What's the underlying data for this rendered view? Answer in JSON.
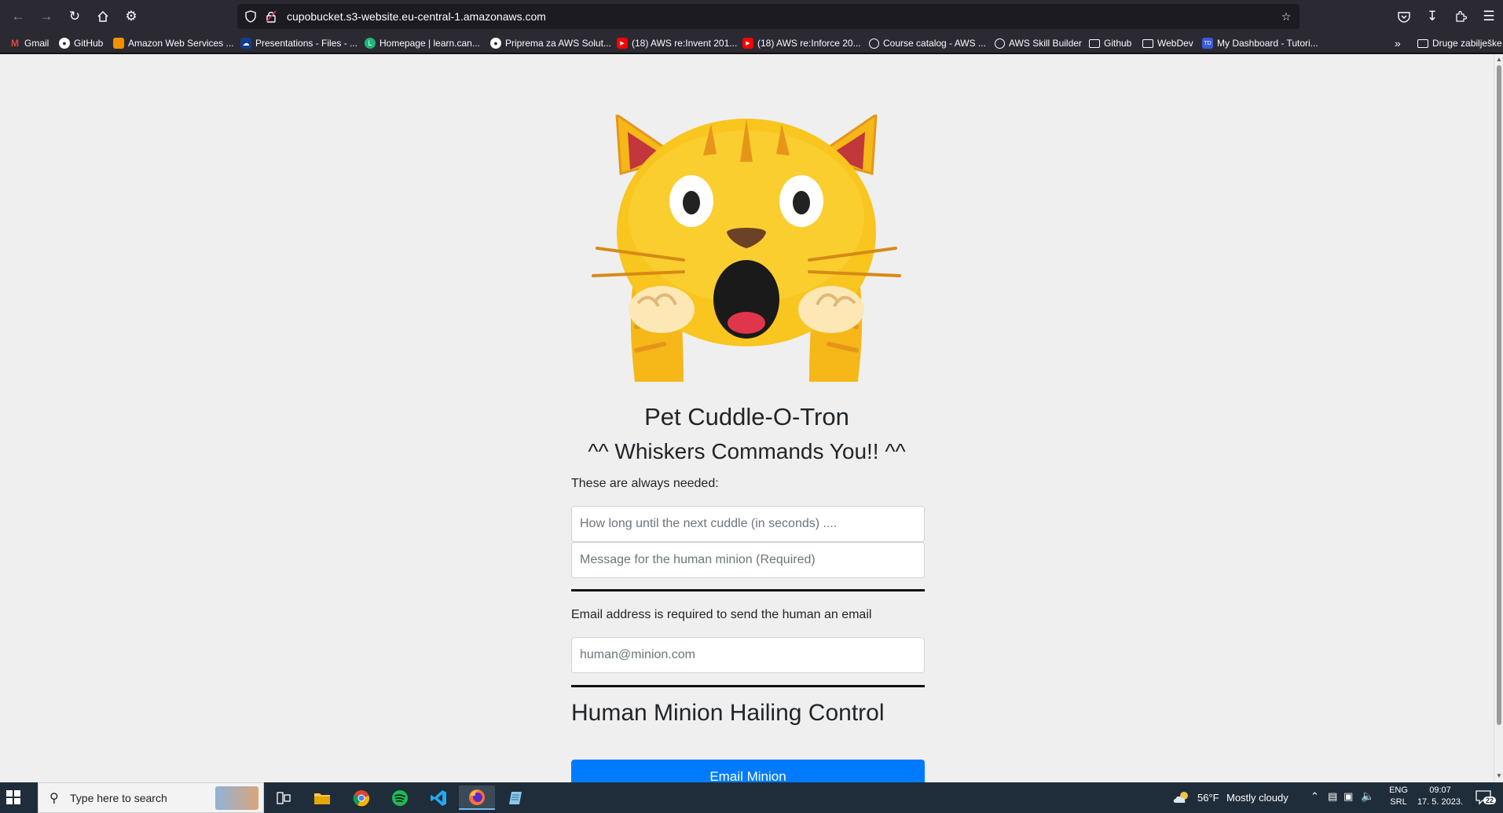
{
  "browser": {
    "url": "cupobucket.s3-website.eu-central-1.amazonaws.com",
    "bookmarks": [
      {
        "label": "Gmail",
        "icon": "gmail-icon",
        "color": "#ea4335"
      },
      {
        "label": "GitHub",
        "icon": "github-icon",
        "color": "#ffffff"
      },
      {
        "label": "Amazon Web Services ...",
        "icon": "aws-icon",
        "color": "#f29100"
      },
      {
        "label": "Presentations - Files - ...",
        "icon": "cloud-icon",
        "color": "#ffffff"
      },
      {
        "label": "Homepage | learn.can...",
        "icon": "learn-icon",
        "color": "#1fb57b"
      },
      {
        "label": "Priprema za AWS Solut...",
        "icon": "github-icon",
        "color": "#ffffff"
      },
      {
        "label": "(18) AWS re:Invent 201...",
        "icon": "youtube-icon",
        "color": "#ff0000"
      },
      {
        "label": "(18) AWS re:Inforce 20...",
        "icon": "youtube-icon",
        "color": "#ff0000"
      },
      {
        "label": "Course catalog - AWS ...",
        "icon": "globe-icon",
        "color": "#ffffff"
      },
      {
        "label": "AWS Skill Builder",
        "icon": "globe-icon",
        "color": "#ffffff"
      },
      {
        "label": "Github",
        "icon": "folder-icon",
        "color": "#ffffff"
      },
      {
        "label": "WebDev",
        "icon": "folder-icon",
        "color": "#ffffff"
      },
      {
        "label": "My Dashboard - Tutori...",
        "icon": "dashboard-icon",
        "color": "#3b5bdb"
      }
    ],
    "other_bookmarks": "Druge zabilješke"
  },
  "page": {
    "title": "Pet Cuddle-O-Tron",
    "subtitle": "^^ Whiskers Commands You!! ^^",
    "always_needed_label": "These are always needed:",
    "wait_placeholder": "How long until the next cuddle (in seconds) ....",
    "message_placeholder": "Message for the human minion (Required)",
    "email_label": "Email address is required to send the human an email",
    "email_placeholder": "human@minion.com",
    "control_heading": "Human Minion Hailing Control",
    "email_button": "Email Minion"
  },
  "taskbar": {
    "search_placeholder": "Type here to search",
    "weather_temp": "56°F",
    "weather_desc": "Mostly cloudy",
    "lang_top": "ENG",
    "lang_bottom": "SRL",
    "time": "09:07",
    "date": "17. 5. 2023.",
    "notifications": "22"
  }
}
